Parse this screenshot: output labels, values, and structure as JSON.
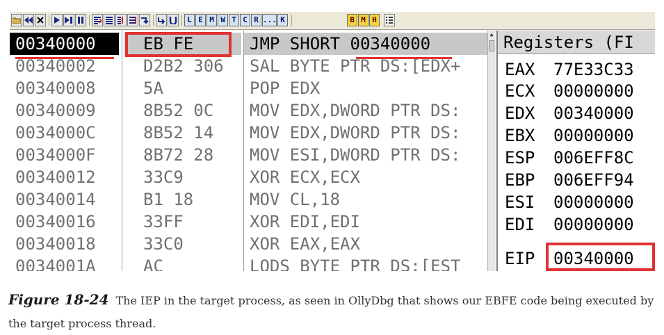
{
  "toolbar": {
    "buttons": [
      {
        "id": "open",
        "icon": "open-folder-icon"
      },
      {
        "id": "rewind",
        "icon": "rewind-icon"
      },
      {
        "id": "close",
        "icon": "close-icon"
      },
      {
        "id": "run",
        "icon": "run-icon"
      },
      {
        "id": "step-run",
        "icon": "run-thread-icon"
      },
      {
        "id": "pause",
        "icon": "pause-icon"
      },
      {
        "id": "step-into",
        "icon": "step-into-icon"
      },
      {
        "id": "step-over",
        "icon": "step-over-icon"
      },
      {
        "id": "trace-into",
        "icon": "trace-into-icon"
      },
      {
        "id": "trace-over",
        "icon": "trace-over-icon"
      },
      {
        "id": "execute-till-return",
        "icon": "execute-till-return-icon"
      },
      {
        "id": "go-to",
        "icon": "go-to-icon"
      }
    ],
    "window_letters": [
      "L",
      "E",
      "M",
      "W",
      "T",
      "C",
      "R",
      "...",
      "K"
    ],
    "extra_letters": [
      "B",
      "M",
      "H"
    ],
    "menu_icon": "list-menu-icon"
  },
  "disasm": {
    "rows": [
      {
        "addr": "00340000",
        "hex": "EB FE",
        "dis": "JMP SHORT 00340000",
        "selected": true
      },
      {
        "addr": "00340002",
        "hex": "D2B2 306",
        "dis": "SAL BYTE PTR DS:[EDX+",
        "selected": false
      },
      {
        "addr": "00340008",
        "hex": "5A",
        "dis": "POP EDX",
        "selected": false
      },
      {
        "addr": "00340009",
        "hex": "8B52 0C",
        "dis": "MOV EDX,DWORD PTR DS:",
        "selected": false
      },
      {
        "addr": "0034000C",
        "hex": "8B52 14",
        "dis": "MOV EDX,DWORD PTR DS:",
        "selected": false
      },
      {
        "addr": "0034000F",
        "hex": "8B72 28",
        "dis": "MOV ESI,DWORD PTR DS:",
        "selected": false
      },
      {
        "addr": "00340012",
        "hex": "33C9",
        "dis": "XOR ECX,ECX",
        "selected": false
      },
      {
        "addr": "00340014",
        "hex": "B1 18",
        "dis": "MOV CL,18",
        "selected": false
      },
      {
        "addr": "00340016",
        "hex": "33FF",
        "dis": "XOR EDI,EDI",
        "selected": false
      },
      {
        "addr": "00340018",
        "hex": "33C0",
        "dis": "XOR EAX,EAX",
        "selected": false
      },
      {
        "addr": "0034001A",
        "hex": "AC",
        "dis": "LODS BYTE PTR DS:[EST",
        "selected": false
      }
    ]
  },
  "registers": {
    "title": "Registers (FI",
    "list": [
      {
        "name": "EAX",
        "value": "77E33C33"
      },
      {
        "name": "ECX",
        "value": "00000000"
      },
      {
        "name": "EDX",
        "value": "00340000"
      },
      {
        "name": "EBX",
        "value": "00000000"
      },
      {
        "name": "ESP",
        "value": "006EFF8C"
      },
      {
        "name": "EBP",
        "value": "006EFF94"
      },
      {
        "name": "ESI",
        "value": "00000000"
      },
      {
        "name": "EDI",
        "value": "00000000"
      }
    ],
    "eip": {
      "name": "EIP",
      "value": "00340000"
    }
  },
  "caption": {
    "label": "Figure 18-24",
    "text": "The IEP in the target process, as seen in OllyDbg that shows our EBFE code being executed by the target process thread."
  },
  "colors": {
    "highlight": "#e03333",
    "selected_row_bg": "#000000",
    "toolbar_letter_blue": "#d4e2f2",
    "toolbar_letter_yellow": "#f5d33c"
  }
}
